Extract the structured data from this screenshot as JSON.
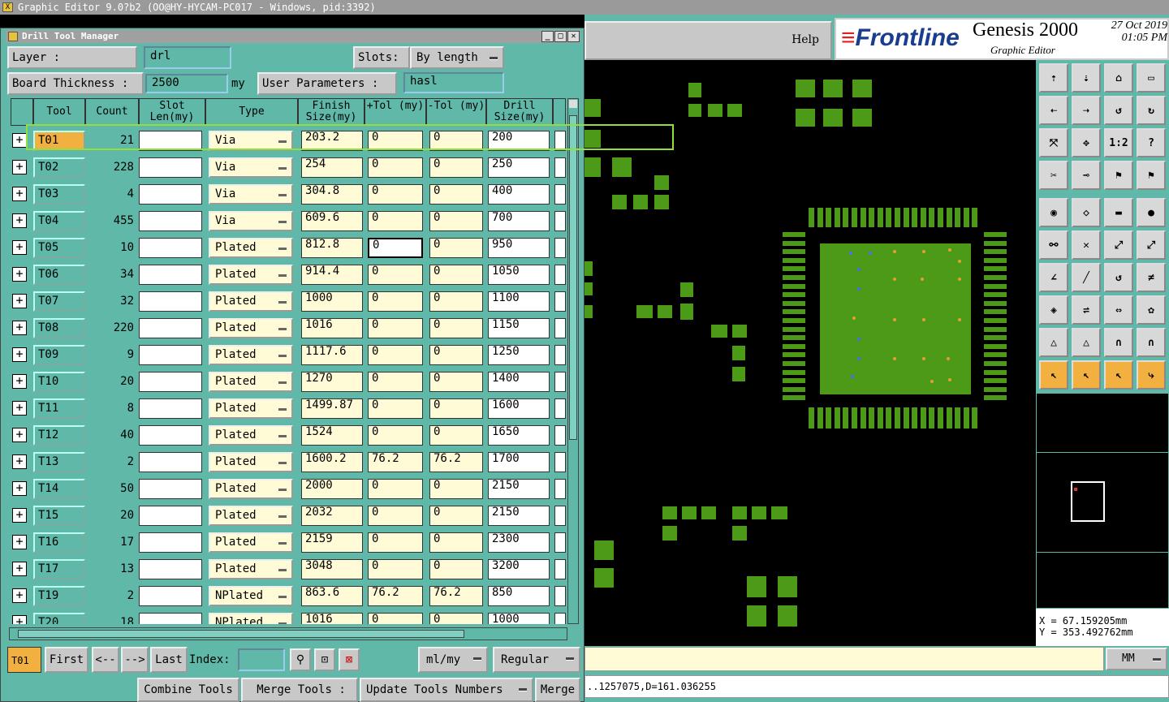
{
  "window": {
    "title": "Graphic Editor 9.0?b2 (OO@HY-HYCAM-PC017 - Windows, pid:3392)"
  },
  "header": {
    "help_label": "Help",
    "brand": "Frontline",
    "product": "Genesis 2000",
    "subtitle": "Graphic Editor",
    "date": "27 Oct 2019",
    "time": "01:05 PM"
  },
  "dialog": {
    "title": "Drill Tool Manager",
    "layer_label": "Layer         :",
    "layer_value": "drl",
    "slots_label": "Slots:",
    "slots_value": "By length",
    "thickness_label": "Board Thickness :",
    "thickness_value": "2500",
    "thickness_unit": "my",
    "user_params_label": "User Parameters :",
    "user_params_value": "hasl",
    "columns": [
      "Tool",
      "Count",
      "Slot Len(my)",
      "Type",
      "Finish Size(my)",
      "+Tol (my)",
      "-Tol (my)",
      "Drill Size(my)"
    ],
    "rows": [
      {
        "tool": "T01",
        "count": "21",
        "type": "Via",
        "finish": "203.2",
        "ptol": "0",
        "ntol": "0",
        "drill": "200"
      },
      {
        "tool": "T02",
        "count": "228",
        "type": "Via",
        "finish": "254",
        "ptol": "0",
        "ntol": "0",
        "drill": "250"
      },
      {
        "tool": "T03",
        "count": "4",
        "type": "Via",
        "finish": "304.8",
        "ptol": "0",
        "ntol": "0",
        "drill": "400"
      },
      {
        "tool": "T04",
        "count": "455",
        "type": "Via",
        "finish": "609.6",
        "ptol": "0",
        "ntol": "0",
        "drill": "700"
      },
      {
        "tool": "T05",
        "count": "10",
        "type": "Plated",
        "finish": "812.8",
        "ptol": "0",
        "ntol": "0",
        "drill": "950"
      },
      {
        "tool": "T06",
        "count": "34",
        "type": "Plated",
        "finish": "914.4",
        "ptol": "0",
        "ntol": "0",
        "drill": "1050"
      },
      {
        "tool": "T07",
        "count": "32",
        "type": "Plated",
        "finish": "1000",
        "ptol": "0",
        "ntol": "0",
        "drill": "1100"
      },
      {
        "tool": "T08",
        "count": "220",
        "type": "Plated",
        "finish": "1016",
        "ptol": "0",
        "ntol": "0",
        "drill": "1150"
      },
      {
        "tool": "T09",
        "count": "9",
        "type": "Plated",
        "finish": "1117.6",
        "ptol": "0",
        "ntol": "0",
        "drill": "1250"
      },
      {
        "tool": "T10",
        "count": "20",
        "type": "Plated",
        "finish": "1270",
        "ptol": "0",
        "ntol": "0",
        "drill": "1400"
      },
      {
        "tool": "T11",
        "count": "8",
        "type": "Plated",
        "finish": "1499.87",
        "ptol": "0",
        "ntol": "0",
        "drill": "1600"
      },
      {
        "tool": "T12",
        "count": "40",
        "type": "Plated",
        "finish": "1524",
        "ptol": "0",
        "ntol": "0",
        "drill": "1650"
      },
      {
        "tool": "T13",
        "count": "2",
        "type": "Plated",
        "finish": "1600.2",
        "ptol": "76.2",
        "ntol": "76.2",
        "drill": "1700"
      },
      {
        "tool": "T14",
        "count": "50",
        "type": "Plated",
        "finish": "2000",
        "ptol": "0",
        "ntol": "0",
        "drill": "2150"
      },
      {
        "tool": "T15",
        "count": "20",
        "type": "Plated",
        "finish": "2032",
        "ptol": "0",
        "ntol": "0",
        "drill": "2150"
      },
      {
        "tool": "T16",
        "count": "17",
        "type": "Plated",
        "finish": "2159",
        "ptol": "0",
        "ntol": "0",
        "drill": "2300"
      },
      {
        "tool": "T17",
        "count": "13",
        "type": "Plated",
        "finish": "3048",
        "ptol": "0",
        "ntol": "0",
        "drill": "3200"
      },
      {
        "tool": "T19",
        "count": "2",
        "type": "NPlated",
        "finish": "863.6",
        "ptol": "76.2",
        "ntol": "76.2",
        "drill": "850"
      },
      {
        "tool": "T20",
        "count": "18",
        "type": "NPlated",
        "finish": "1016",
        "ptol": "0",
        "ntol": "0",
        "drill": "1000"
      }
    ],
    "current_tool": "T01",
    "first_label": "First",
    "prev_label": "<--",
    "next_label": "-->",
    "last_label": "Last",
    "index_label": "Index:",
    "units_value": "ml/my",
    "mode_value": "Regular",
    "combine_label": "Combine Tools",
    "merge_tools_label": "Merge Tools :",
    "update_label": "Update Tools Numbers",
    "merge_label": "Merge"
  },
  "coords": {
    "x": "X  =  67.159205mm",
    "y": "Y  = 353.492762mm"
  },
  "units_select": "MM",
  "command_line": "..1257075,D=161.036255",
  "colors": {
    "accent": "#5fb8a8",
    "pad": "#4c9a18",
    "field": "#fffbd6",
    "selected_tool": "#f2b040",
    "highlight": "#8fe03a"
  }
}
